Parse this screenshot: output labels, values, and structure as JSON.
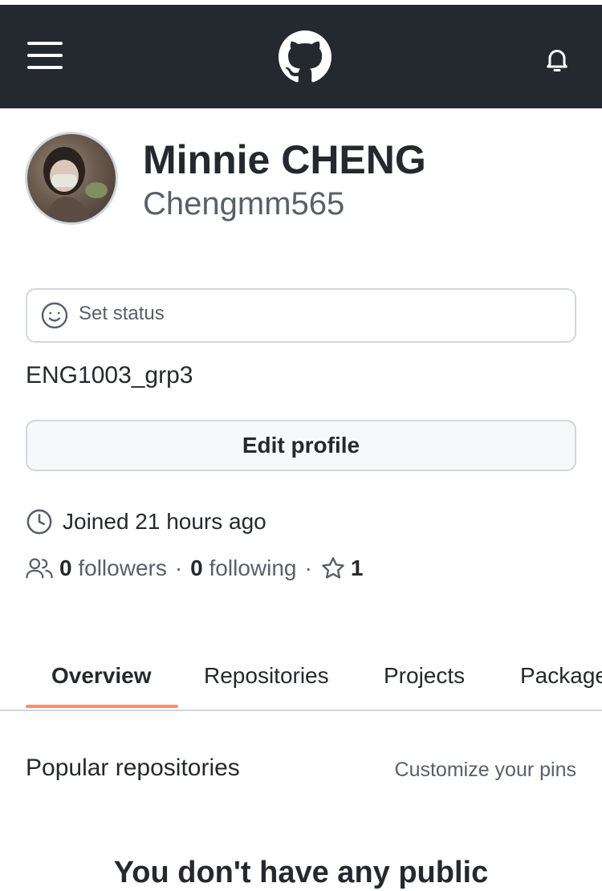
{
  "header": {
    "menu_icon": "hamburger-icon",
    "logo_icon": "github-octocat-icon",
    "notifications_icon": "bell-icon",
    "background_color": "#24292f"
  },
  "profile": {
    "display_name": "Minnie CHENG",
    "username": "Chengmm565",
    "status_placeholder": "Set status",
    "bio": "ENG1003_grp3",
    "edit_button_label": "Edit profile",
    "joined_text": "Joined 21 hours ago",
    "followers_count": "0",
    "followers_label": "followers",
    "following_count": "0",
    "following_label": "following",
    "stars_count": "1",
    "separator": "·"
  },
  "tabs": [
    {
      "label": "Overview",
      "active": true
    },
    {
      "label": "Repositories",
      "active": false
    },
    {
      "label": "Projects",
      "active": false
    },
    {
      "label": "Packages",
      "active": false
    }
  ],
  "accent_color": "#fd8c73",
  "popular": {
    "title": "Popular repositories",
    "customize_link": "Customize your pins",
    "empty_message": "You don't have any public"
  }
}
